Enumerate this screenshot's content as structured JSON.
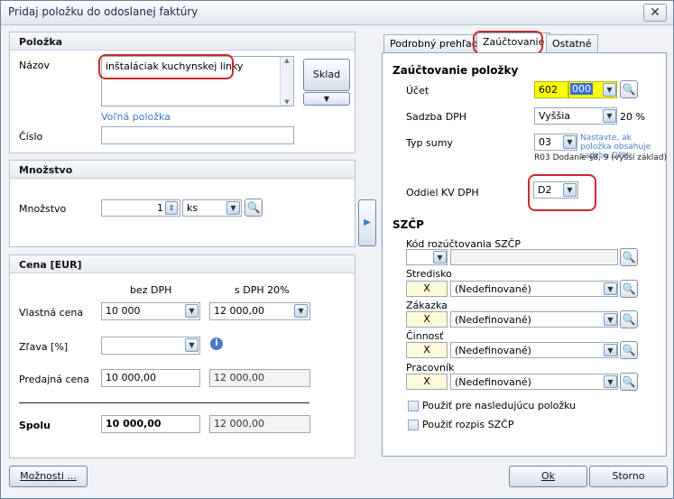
{
  "window": {
    "title": "Pridaj položku do odoslanej faktúry",
    "close_glyph": "✕"
  },
  "polozka": {
    "header": "Položka",
    "nazov_label": "Názov",
    "nazov_value": "inštaláciak kuchynskej linky",
    "sklad_button": "Sklad",
    "volna_polozka_link": "Voľná položka",
    "cislo_label": "Číslo",
    "cislo_value": ""
  },
  "mnozstvo": {
    "header": "Množstvo",
    "label": "Množstvo",
    "value": "1",
    "unit": "ks"
  },
  "cena": {
    "header": "Cena [EUR]",
    "col_bez_dph": "bez DPH",
    "col_s_dph": "s DPH 20%",
    "rows": [
      {
        "label": "Vlastná cena",
        "bez": "10 000",
        "s": "12 000,00"
      },
      {
        "label": "Zľava [%]",
        "bez": "",
        "s": ""
      },
      {
        "label": "Predajná cena",
        "bez": "10 000,00",
        "s": "12 000,00"
      }
    ],
    "spolu_label": "Spolu",
    "spolu_bez": "10 000,00",
    "spolu_s": "12 000,00"
  },
  "tabs": [
    "Podrobný prehľad",
    "Zaúčtovanie",
    "Ostatné"
  ],
  "zauctovanie": {
    "title": "Zaúčtovanie položky",
    "ucet_label": "Účet",
    "ucet_1": "602",
    "ucet_2": "000",
    "sadzba_label": "Sadzba DPH",
    "sadzba_value": "Vyššia",
    "sadzba_pct": "20 %",
    "typ_label": "Typ sumy",
    "typ_value": "03",
    "typ_note": "Nastavte, ak položka obsahuje sadzbu DPH",
    "typ_desc": "R03 Dodanie §8, 9 (vyšší základ)",
    "oddiel_label": "Oddiel KV DPH",
    "oddiel_value": "D2"
  },
  "szcp": {
    "title": "SZČP",
    "kod_label": "Kód rozúčtovania SZČP",
    "rows": [
      {
        "label": "Stredisko",
        "x": "X",
        "value": "(Nedefinované)"
      },
      {
        "label": "Zákazka",
        "x": "X",
        "value": "(Nedefinované)"
      },
      {
        "label": "Činnosť",
        "x": "X",
        "value": "(Nedefinované)"
      },
      {
        "label": "Pracovník",
        "x": "X",
        "value": "(Nedefinované)"
      }
    ],
    "check_1": "Použiť pre nasledujúcu položku",
    "check_2": "Použiť rozpis SZČP"
  },
  "footer": {
    "moznosti": "Možnosti ...",
    "ok": "Ok",
    "storno": "Storno"
  },
  "colors": {
    "highlight": "#cc2a2a",
    "yellow": "#ffff00",
    "selected": "#3a6fd0",
    "link": "#3b7bbf"
  }
}
